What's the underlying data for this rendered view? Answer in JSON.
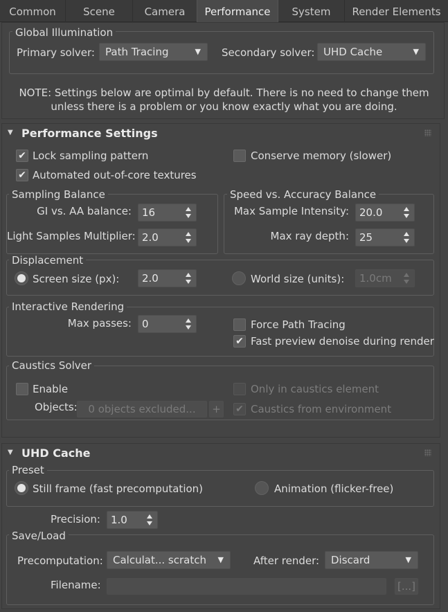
{
  "tabs": [
    "Common",
    "Scene",
    "Camera",
    "Performance",
    "System",
    "Render Elements"
  ],
  "global_illumination": {
    "title": "Global Illumination",
    "primary_label": "Primary solver:",
    "primary_value": "Path Tracing",
    "secondary_label": "Secondary solver:",
    "secondary_value": "UHD Cache"
  },
  "note": {
    "line1": "NOTE: Settings below are optimal by default. There is no need to change them",
    "line2": "unless there is a problem or you know exactly what you are doing."
  },
  "performance": {
    "title": "Performance Settings",
    "lock_sampling": {
      "label": "Lock sampling pattern",
      "checked": true
    },
    "conserve_memory": {
      "label": "Conserve memory (slower)",
      "checked": false
    },
    "out_of_core": {
      "label": "Automated out-of-core textures",
      "checked": true
    },
    "sampling_balance": {
      "title": "Sampling Balance",
      "gi_aa_label": "GI vs. AA balance:",
      "gi_aa_value": "16",
      "light_mult_label": "Light Samples Multiplier:",
      "light_mult_value": "2.0"
    },
    "speed_accuracy": {
      "title": "Speed vs. Accuracy Balance",
      "max_intensity_label": "Max Sample Intensity:",
      "max_intensity_value": "20.0",
      "max_ray_label": "Max ray depth:",
      "max_ray_value": "25"
    },
    "displacement": {
      "title": "Displacement",
      "screen_label": "Screen size (px):",
      "screen_value": "2.0",
      "screen_selected": true,
      "world_label": "World size (units):",
      "world_value": "1.0cm",
      "world_selected": false
    },
    "interactive": {
      "title": "Interactive Rendering",
      "max_passes_label": "Max passes:",
      "max_passes_value": "0",
      "force_pt": {
        "label": "Force Path Tracing",
        "checked": false
      },
      "fast_preview": {
        "label": "Fast preview denoise during render",
        "checked": true
      }
    },
    "caustics": {
      "title": "Caustics Solver",
      "enable": {
        "label": "Enable",
        "checked": false
      },
      "only_caustics": {
        "label": "Only in caustics element",
        "checked": false
      },
      "objects_label": "Objects:",
      "objects_button": "0 objects excluded...",
      "plus": "+",
      "from_env": {
        "label": "Caustics from environment",
        "checked": true
      }
    }
  },
  "uhd": {
    "title": "UHD Cache",
    "preset_title": "Preset",
    "still_label": "Still frame (fast precomputation)",
    "still_selected": true,
    "anim_label": "Animation (flicker-free)",
    "anim_selected": false,
    "precision_label": "Precision:",
    "precision_value": "1.0",
    "saveload_title": "Save/Load",
    "precomp_label": "Precomputation:",
    "precomp_value": "Calculat... scratch",
    "after_label": "After render:",
    "after_value": "Discard",
    "filename_label": "Filename:",
    "filename_value": "",
    "browse": "[...]"
  },
  "glyphs": {
    "check": "✔",
    "dropdown": "▼",
    "collapse": "▼"
  }
}
